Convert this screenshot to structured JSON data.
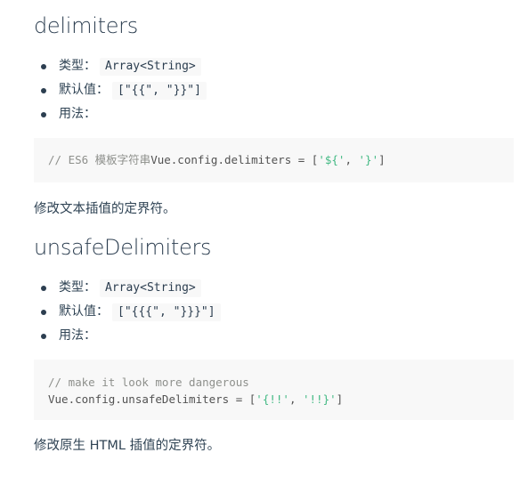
{
  "sections": [
    {
      "title": "delimiters",
      "type_label": "类型：",
      "type_value": "Array<String>",
      "default_label": "默认值：",
      "default_value": "[\"{{\", \"}}\"]",
      "usage_label": "用法：",
      "code": {
        "comment": "// ES6 模板字符串",
        "prefix": "Vue.config.delimiters = [",
        "str1": "'${'",
        "sep": ", ",
        "str2": "'}'",
        "suffix": "]"
      },
      "description": "修改文本插值的定界符。"
    },
    {
      "title": "unsafeDelimiters",
      "type_label": "类型：",
      "type_value": "Array<String>",
      "default_label": "默认值：",
      "default_value": "[\"{{{\", \"}}}\"]",
      "usage_label": "用法：",
      "code": {
        "comment": "// make it look more dangerous",
        "prefix": "Vue.config.unsafeDelimiters = [",
        "str1": "'{!!'",
        "sep": ", ",
        "str2": "'!!}'",
        "suffix": "]"
      },
      "description": "修改原生 HTML 插值的定界符。"
    }
  ],
  "colors": {
    "heading": "#2c3e50",
    "text": "#304455",
    "code_bg": "#f8f8f8",
    "string": "#42b983",
    "comment": "#8e908c"
  }
}
